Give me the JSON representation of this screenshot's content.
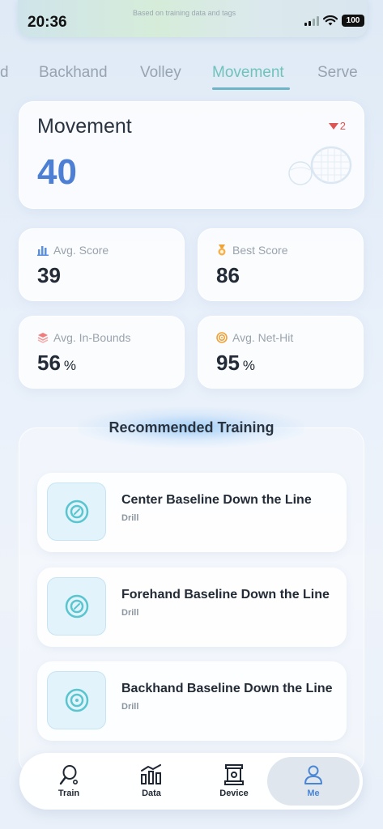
{
  "status_bar": {
    "time": "20:36",
    "hint": "Based on training data and tags",
    "battery": "100"
  },
  "tabs": [
    {
      "label": "d",
      "active": false
    },
    {
      "label": "Backhand",
      "active": false
    },
    {
      "label": "Volley",
      "active": false
    },
    {
      "label": "Movement",
      "active": true
    },
    {
      "label": "Serve",
      "active": false
    }
  ],
  "hero": {
    "title": "Movement",
    "score": "40",
    "delta": "2",
    "delta_direction": "down"
  },
  "stats": [
    {
      "label": "Avg. Score",
      "value": "39",
      "unit": "",
      "icon": "bar-chart-icon"
    },
    {
      "label": "Best Score",
      "value": "86",
      "unit": "",
      "icon": "medal-icon"
    },
    {
      "label": "Avg. In-Bounds",
      "value": "56",
      "unit": "%",
      "icon": "layers-icon"
    },
    {
      "label": "Avg. Net-Hit",
      "value": "95",
      "unit": "%",
      "icon": "target-icon"
    }
  ],
  "recommended": {
    "title": "Recommended Training",
    "items": [
      {
        "title": "Center Baseline Down the Line",
        "type": "Drill"
      },
      {
        "title": "Forehand Baseline Down the Line",
        "type": "Drill"
      },
      {
        "title": "Backhand Baseline Down the Line",
        "type": "Drill"
      }
    ]
  },
  "nav": [
    {
      "label": "Train",
      "icon": "racket-icon",
      "active": false
    },
    {
      "label": "Data",
      "icon": "bar-chart-icon",
      "active": false
    },
    {
      "label": "Device",
      "icon": "device-icon",
      "active": false
    },
    {
      "label": "Me",
      "icon": "user-icon",
      "active": true
    }
  ],
  "colors": {
    "accent": "#4d7fd4",
    "active_tab": "#6fc3bb",
    "delta_down": "#de5555",
    "nav_active": "#4a86d6"
  }
}
